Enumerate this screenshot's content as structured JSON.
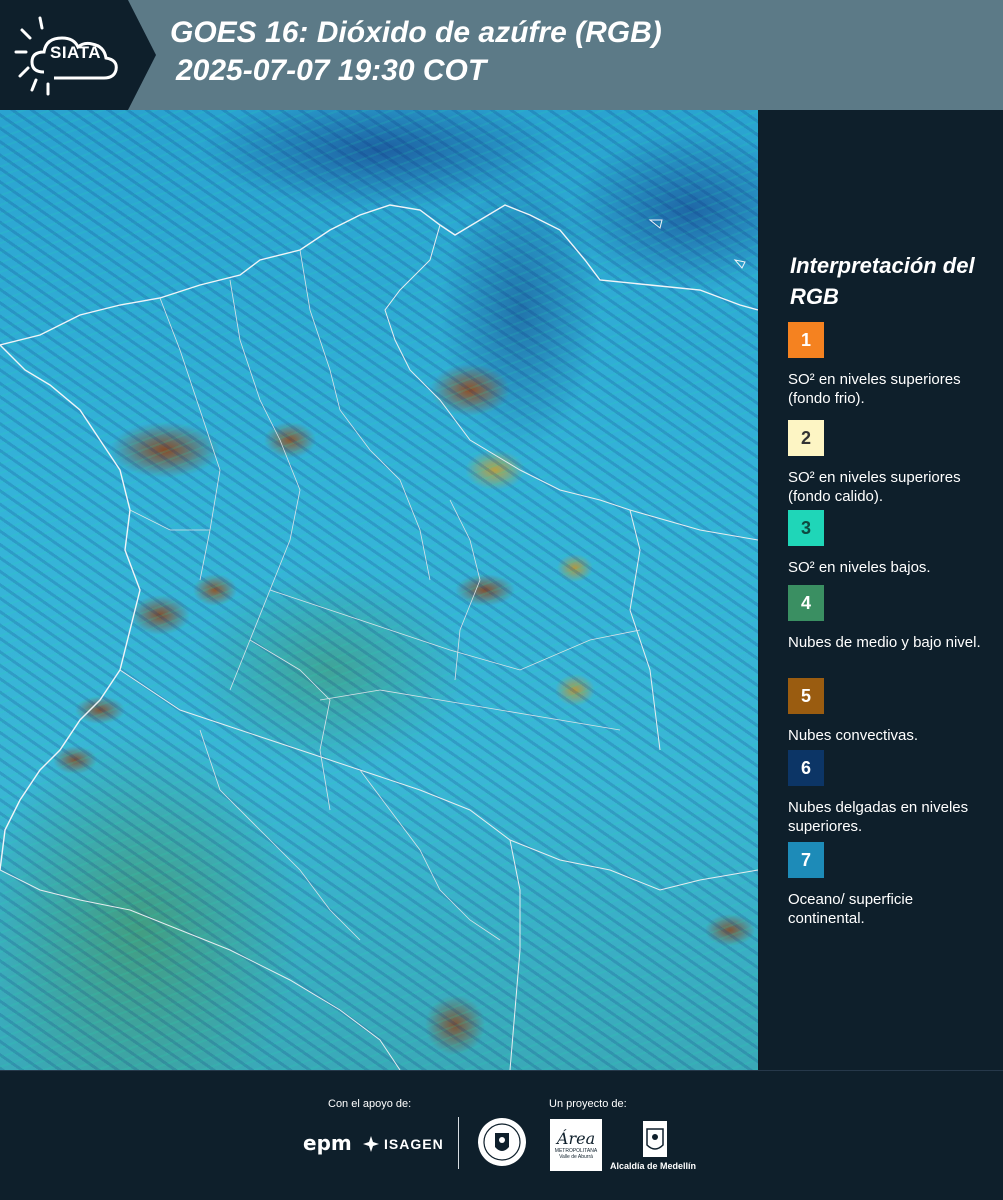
{
  "header": {
    "logo_text": "SIATA",
    "title_line1": "GOES 16: Dióxido de azúfre (RGB)",
    "title_line2": "2025-07-07 19:30 COT"
  },
  "legend": {
    "title": "Interpretación del RGB",
    "items": [
      {
        "number": "1",
        "label": "SO² en niveles superiores (fondo frio).",
        "color": "#f58220"
      },
      {
        "number": "2",
        "label": "SO² en niveles superiores (fondo calido).",
        "color": "#fdf5c4"
      },
      {
        "number": "3",
        "label": "SO² en niveles bajos.",
        "color": "#1fd6b8"
      },
      {
        "number": "4",
        "label": "Nubes de medio y bajo nivel.",
        "color": "#3a8f62"
      },
      {
        "number": "5",
        "label": "Nubes convectivas.",
        "color": "#9a5c10"
      },
      {
        "number": "6",
        "label": "Nubes delgadas en niveles superiores.",
        "color": "#0c3566"
      },
      {
        "number": "7",
        "label": "Oceano/ superficie continental.",
        "color": "#1d8bb8"
      }
    ]
  },
  "footer": {
    "support_label": "Con el apoyo de:",
    "project_label": "Un proyecto de:",
    "epm_logo_text": "epm",
    "isagen_logo_text": "ISAGEN",
    "area_logo_text": "Área",
    "area_logo_subtext": "METROPOLITANA",
    "area_logo_subtext2": "Valle de Aburrá",
    "alcaldia_text": "Alcaldía de Medellín"
  }
}
